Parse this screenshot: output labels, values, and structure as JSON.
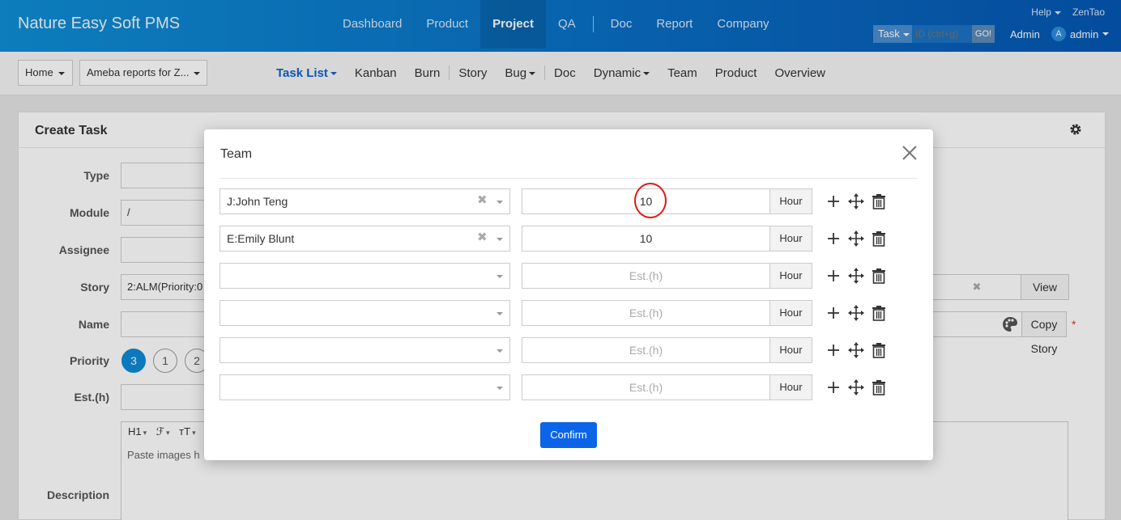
{
  "app": {
    "brand": "Nature Easy Soft PMS",
    "main_nav": [
      "Dashboard",
      "Product",
      "Project",
      "QA",
      "Doc",
      "Report",
      "Company"
    ],
    "active_main": "Project",
    "help_label": "Help",
    "zentao_label": "ZenTao",
    "search_type": "Task",
    "search_placeholder": "ID (ctrl+g)",
    "search_go": "GO!",
    "user_role": "Admin",
    "user_avatar": "A",
    "user_name": "admin"
  },
  "subnav": {
    "breadcrumb_home": "Home",
    "breadcrumb_project": "Ameba reports for Z...",
    "items": [
      "Task List",
      "Kanban",
      "Burn",
      "Story",
      "Bug",
      "Doc",
      "Dynamic",
      "Team",
      "Product",
      "Overview"
    ],
    "active": "Task List"
  },
  "form": {
    "title": "Create Task",
    "labels": {
      "type": "Type",
      "module": "Module",
      "assignee": "Assignee",
      "story": "Story",
      "name": "Name",
      "priority": "Priority",
      "estimate": "Est.(h)",
      "description": "Description"
    },
    "module_value": "/",
    "story_value": "2:ALM(Priority:0",
    "view_button": "View",
    "copy_button": "Copy",
    "story_link": "Story",
    "priority_options": [
      "3",
      "1",
      "2"
    ],
    "editor_toolbar": [
      "H1",
      "ℱ",
      "ᴛT"
    ],
    "description_placeholder": "Paste images h"
  },
  "modal": {
    "title": "Team",
    "hour_label": "Hour",
    "est_placeholder": "Est.(h)",
    "confirm_label": "Confirm",
    "rows": [
      {
        "member": "J:John Teng",
        "estimate": "10"
      },
      {
        "member": "E:Emily Blunt",
        "estimate": "10"
      },
      {
        "member": "",
        "estimate": ""
      },
      {
        "member": "",
        "estimate": ""
      },
      {
        "member": "",
        "estimate": ""
      },
      {
        "member": "",
        "estimate": ""
      }
    ]
  },
  "icons": {
    "add": "plus-icon",
    "move": "move-arrows-icon",
    "delete": "trash-icon",
    "close": "close-icon",
    "settings": "gear-icon",
    "palette": "palette-icon"
  },
  "colors": {
    "header_start": "#0f8fd6",
    "header_end": "#0557b3",
    "primary_button": "#0c64e8",
    "active_subnav": "#0c64d0",
    "highlight_ring": "#e01818"
  }
}
